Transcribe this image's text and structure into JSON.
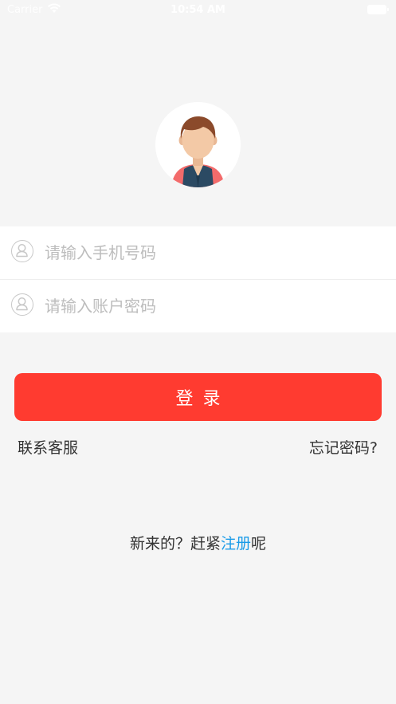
{
  "status_bar": {
    "carrier": "Carrier",
    "time": "10:54 AM"
  },
  "login_form": {
    "phone_placeholder": "请输入手机号码",
    "password_placeholder": "请输入账户密码",
    "login_label": "登录"
  },
  "links": {
    "contact_service": "联系客服",
    "forgot_password": "忘记密码?"
  },
  "register": {
    "prefix": "新来的？赶紧",
    "link": "注册",
    "suffix": "呢"
  },
  "colors": {
    "accent": "#ff3b30",
    "link": "#1a9be8",
    "background": "#f5f5f5"
  },
  "icons": {
    "avatar": "avatar-icon",
    "user_field": "user-icon",
    "password_field": "user-icon"
  }
}
